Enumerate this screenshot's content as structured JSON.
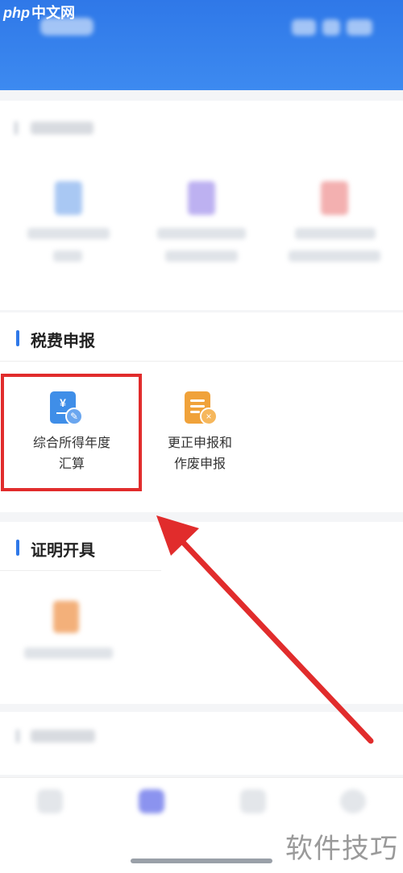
{
  "watermark": {
    "brand_prefix": "php",
    "brand_suffix": "中文网",
    "bottom_text": "软件技巧"
  },
  "header": {
    "title": ""
  },
  "sections": {
    "top_blurred": {
      "title": "",
      "items": [
        {
          "label_line1": "",
          "label_line2": "",
          "icon_color": "#9cc1f2"
        },
        {
          "label_line1": "",
          "label_line2": "",
          "icon_color": "#b7a9f0"
        },
        {
          "label_line1": "",
          "label_line2": "",
          "icon_color": "#f2a7a7"
        }
      ]
    },
    "tax_filing": {
      "title": "税费申报",
      "items": [
        {
          "label_line1": "综合所得年度",
          "label_line2": "汇算",
          "icon": "yuan-document-icon",
          "icon_color": "#3f8ee8"
        },
        {
          "label_line1": "更正申报和",
          "label_line2": "作废申报",
          "icon": "document-cancel-icon",
          "icon_color": "#f0a23a"
        }
      ]
    },
    "certificates": {
      "title": "证明开具",
      "items": [
        {
          "label_line1": "",
          "icon_color": "#f0a868"
        }
      ]
    },
    "bottom_blurred": {
      "title": ""
    }
  },
  "bottom_nav": {
    "items": [
      {
        "label": "",
        "icon": "home-icon"
      },
      {
        "label": "",
        "icon": "service-icon"
      },
      {
        "label": "",
        "icon": "consult-icon"
      },
      {
        "label": "",
        "icon": "profile-icon"
      }
    ]
  },
  "colors": {
    "header": "#2f78e8",
    "highlight": "#e12c2c",
    "arrow": "#e12c2c"
  }
}
